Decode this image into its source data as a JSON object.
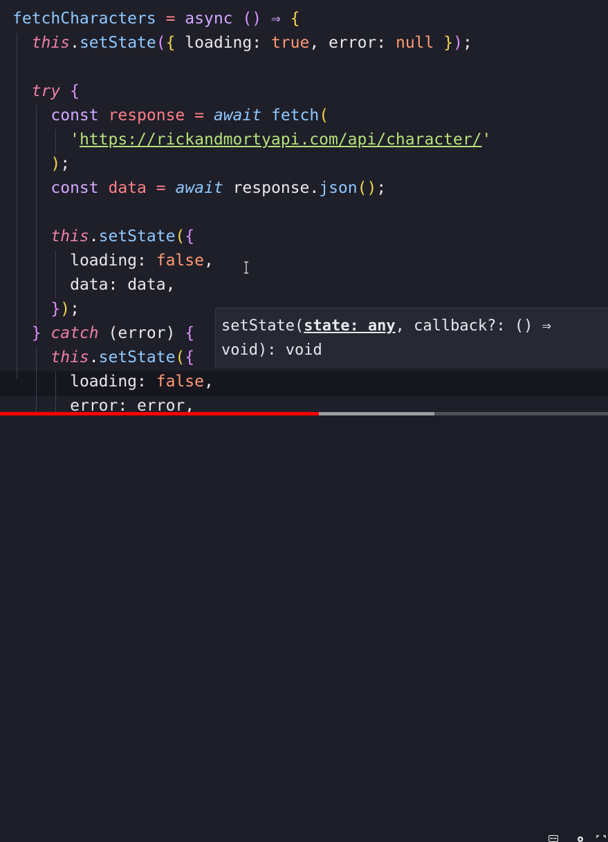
{
  "code_lines": [
    {
      "tokens": [
        {
          "t": "fetchCharacters",
          "c": "t-fn"
        },
        {
          "t": " ",
          "c": "t-plain"
        },
        {
          "t": "=",
          "c": "t-op"
        },
        {
          "t": " ",
          "c": "t-plain"
        },
        {
          "t": "async",
          "c": "t-kwp"
        },
        {
          "t": " ",
          "c": "t-plain"
        },
        {
          "t": "()",
          "c": "t-paren"
        },
        {
          "t": " ",
          "c": "t-plain"
        },
        {
          "t": "⇒",
          "c": "t-kwp"
        },
        {
          "t": " ",
          "c": "t-plain"
        },
        {
          "t": "{",
          "c": "t-brace"
        }
      ]
    },
    {
      "tokens": [
        {
          "t": "  ",
          "c": "t-plain"
        },
        {
          "t": "this",
          "c": "t-this"
        },
        {
          "t": ".",
          "c": "t-punc"
        },
        {
          "t": "setState",
          "c": "t-prop"
        },
        {
          "t": "(",
          "c": "t-paren"
        },
        {
          "t": "{",
          "c": "t-brace"
        },
        {
          "t": " loading",
          "c": "t-key"
        },
        {
          "t": ": ",
          "c": "t-punc"
        },
        {
          "t": "true",
          "c": "t-bool"
        },
        {
          "t": ", ",
          "c": "t-punc"
        },
        {
          "t": "error",
          "c": "t-key"
        },
        {
          "t": ": ",
          "c": "t-punc"
        },
        {
          "t": "null",
          "c": "t-bool"
        },
        {
          "t": " ",
          "c": "t-plain"
        },
        {
          "t": "}",
          "c": "t-brace"
        },
        {
          "t": ")",
          "c": "t-paren"
        },
        {
          "t": ";",
          "c": "t-punc"
        }
      ]
    },
    {
      "tokens": []
    },
    {
      "tokens": [
        {
          "t": "  ",
          "c": "t-plain"
        },
        {
          "t": "try",
          "c": "t-kw"
        },
        {
          "t": " ",
          "c": "t-plain"
        },
        {
          "t": "{",
          "c": "t-paren"
        }
      ]
    },
    {
      "tokens": [
        {
          "t": "    ",
          "c": "t-plain"
        },
        {
          "t": "const",
          "c": "t-kwp"
        },
        {
          "t": " ",
          "c": "t-plain"
        },
        {
          "t": "response",
          "c": "t-var"
        },
        {
          "t": " ",
          "c": "t-plain"
        },
        {
          "t": "=",
          "c": "t-op"
        },
        {
          "t": " ",
          "c": "t-plain"
        },
        {
          "t": "await",
          "c": "t-await"
        },
        {
          "t": " ",
          "c": "t-plain"
        },
        {
          "t": "fetch",
          "c": "t-fn"
        },
        {
          "t": "(",
          "c": "t-brace"
        }
      ]
    },
    {
      "tokens": [
        {
          "t": "      ",
          "c": "t-plain"
        },
        {
          "t": "'",
          "c": "t-str"
        },
        {
          "t": "https://rickandmortyapi.com/api/character/",
          "c": "t-url"
        },
        {
          "t": "'",
          "c": "t-str"
        }
      ]
    },
    {
      "tokens": [
        {
          "t": "    ",
          "c": "t-plain"
        },
        {
          "t": ")",
          "c": "t-brace"
        },
        {
          "t": ";",
          "c": "t-punc"
        }
      ]
    },
    {
      "tokens": [
        {
          "t": "    ",
          "c": "t-plain"
        },
        {
          "t": "const",
          "c": "t-kwp"
        },
        {
          "t": " ",
          "c": "t-plain"
        },
        {
          "t": "data",
          "c": "t-var"
        },
        {
          "t": " ",
          "c": "t-plain"
        },
        {
          "t": "=",
          "c": "t-op"
        },
        {
          "t": " ",
          "c": "t-plain"
        },
        {
          "t": "await",
          "c": "t-await"
        },
        {
          "t": " ",
          "c": "t-plain"
        },
        {
          "t": "response",
          "c": "t-plain"
        },
        {
          "t": ".",
          "c": "t-punc"
        },
        {
          "t": "json",
          "c": "t-fn"
        },
        {
          "t": "()",
          "c": "t-brace"
        },
        {
          "t": ";",
          "c": "t-punc"
        }
      ]
    },
    {
      "tokens": []
    },
    {
      "tokens": [
        {
          "t": "    ",
          "c": "t-plain"
        },
        {
          "t": "this",
          "c": "t-this"
        },
        {
          "t": ".",
          "c": "t-punc"
        },
        {
          "t": "setState",
          "c": "t-prop"
        },
        {
          "t": "(",
          "c": "t-brace"
        },
        {
          "t": "{",
          "c": "t-paren"
        }
      ]
    },
    {
      "tokens": [
        {
          "t": "      ",
          "c": "t-plain"
        },
        {
          "t": "loading",
          "c": "t-key"
        },
        {
          "t": ": ",
          "c": "t-punc"
        },
        {
          "t": "false",
          "c": "t-bool"
        },
        {
          "t": ",",
          "c": "t-punc"
        }
      ]
    },
    {
      "tokens": [
        {
          "t": "      ",
          "c": "t-plain"
        },
        {
          "t": "data",
          "c": "t-key"
        },
        {
          "t": ": ",
          "c": "t-punc"
        },
        {
          "t": "data",
          "c": "t-plain"
        },
        {
          "t": ",",
          "c": "t-punc"
        }
      ]
    },
    {
      "tokens": [
        {
          "t": "    ",
          "c": "t-plain"
        },
        {
          "t": "}",
          "c": "t-paren"
        },
        {
          "t": ")",
          "c": "t-brace"
        },
        {
          "t": ";",
          "c": "t-punc"
        }
      ]
    },
    {
      "tokens": [
        {
          "t": "  ",
          "c": "t-plain"
        },
        {
          "t": "}",
          "c": "t-paren"
        },
        {
          "t": " ",
          "c": "t-plain"
        },
        {
          "t": "catch",
          "c": "t-kw"
        },
        {
          "t": " ",
          "c": "t-plain"
        },
        {
          "t": "(",
          "c": "t-plain"
        },
        {
          "t": "error",
          "c": "t-plain"
        },
        {
          "t": ")",
          "c": "t-plain"
        },
        {
          "t": " ",
          "c": "t-plain"
        },
        {
          "t": "{",
          "c": "t-paren"
        }
      ]
    },
    {
      "tokens": [
        {
          "t": "    ",
          "c": "t-plain"
        },
        {
          "t": "this",
          "c": "t-this"
        },
        {
          "t": ".",
          "c": "t-punc"
        },
        {
          "t": "setState",
          "c": "t-prop"
        },
        {
          "t": "(",
          "c": "t-brace"
        },
        {
          "t": "{",
          "c": "t-paren"
        }
      ]
    },
    {
      "tokens": [
        {
          "t": "      ",
          "c": "t-plain"
        },
        {
          "t": "loading",
          "c": "t-key"
        },
        {
          "t": ": ",
          "c": "t-punc"
        },
        {
          "t": "false",
          "c": "t-bool"
        },
        {
          "t": ",",
          "c": "t-punc"
        }
      ]
    },
    {
      "tokens": [
        {
          "t": "      ",
          "c": "t-plain"
        },
        {
          "t": "error",
          "c": "t-key"
        },
        {
          "t": ": ",
          "c": "t-punc"
        },
        {
          "t": "error",
          "c": "t-plain"
        },
        {
          "t": ",",
          "c": "t-punc"
        }
      ]
    }
  ],
  "tooltip": {
    "fn_name": "setState(",
    "param": "state: any",
    "rest_line1": ", callback?: () ⇒",
    "line2": "void): void"
  },
  "video_player": {
    "played_fraction": 0.525,
    "buffered_fraction": 0.715,
    "played_color": "#ff0000",
    "icons": [
      "subtitles-icon",
      "settings-gear-icon",
      "fullscreen-icon"
    ]
  }
}
